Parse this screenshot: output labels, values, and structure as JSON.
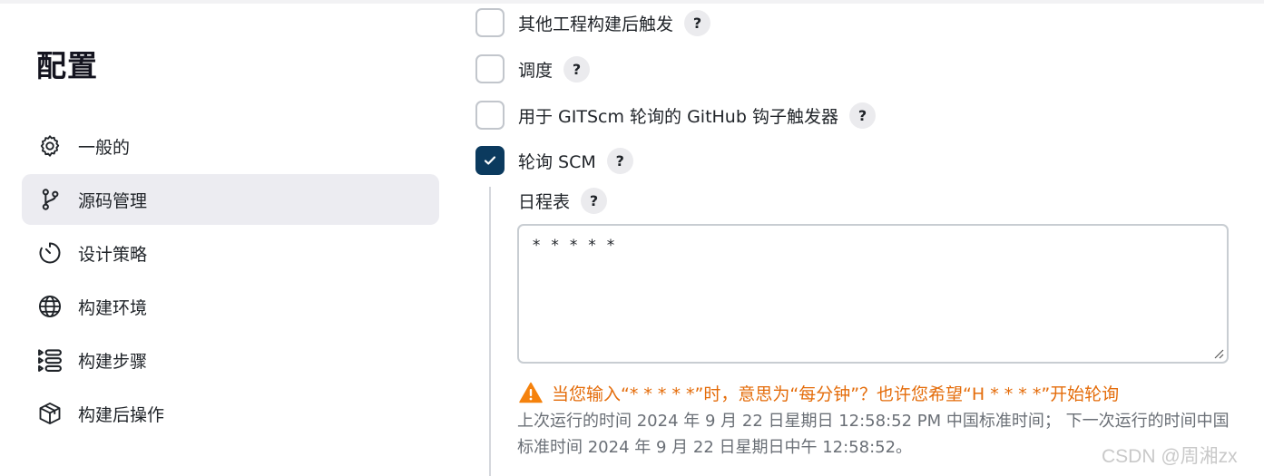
{
  "page": {
    "title": "配置"
  },
  "sidebar": {
    "items": [
      {
        "label": "一般的",
        "icon": "gear-icon",
        "active": false
      },
      {
        "label": "源码管理",
        "icon": "branch-icon",
        "active": true
      },
      {
        "label": "设计策略",
        "icon": "timer-icon",
        "active": false
      },
      {
        "label": "构建环境",
        "icon": "globe-icon",
        "active": false
      },
      {
        "label": "构建步骤",
        "icon": "list-steps-icon",
        "active": false
      },
      {
        "label": "构建后操作",
        "icon": "package-icon",
        "active": false
      }
    ]
  },
  "triggers": {
    "options": [
      {
        "label": "其他工程构建后触发",
        "checked": false
      },
      {
        "label": "调度",
        "checked": false
      },
      {
        "label": "用于 GITScm 轮询的 GitHub 钩子触发器",
        "checked": false
      },
      {
        "label": "轮询 SCM",
        "checked": true
      }
    ],
    "help_label": "?"
  },
  "schedule": {
    "label": "日程表",
    "value": "* * * * *",
    "warning": "当您输入“* * * * *”时，意思为“每分钟”？也许您希望“H * * * *”开始轮询",
    "info": "上次运行的时间 2024 年 9 月 22 日星期日 12:58:52 PM 中国标准时间； 下一次运行的时间中国标准时间 2024 年 9 月 22 日星期日中午 12:58:52。"
  },
  "watermark": "CSDN @周湘zx",
  "colors": {
    "accent": "#0b3a5e",
    "warning": "#e46c0a",
    "active_bg": "#ececf1"
  }
}
